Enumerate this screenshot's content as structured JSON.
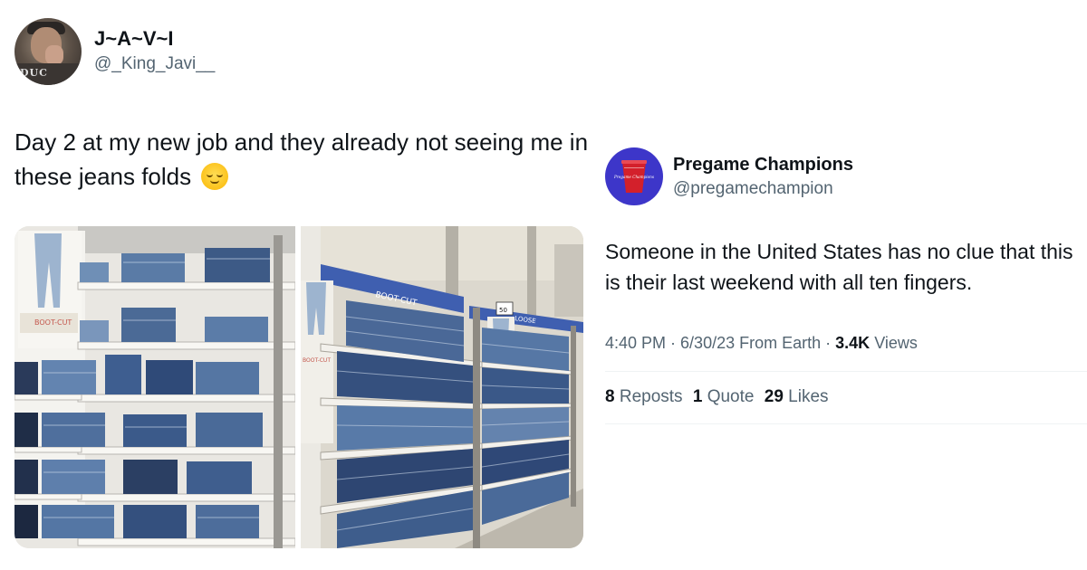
{
  "tweet1": {
    "display_name": "J~A~V~I",
    "handle": "@_King_Javi__",
    "avatar_shirt_text": "DUC",
    "text": "Day 2 at my new job and they already not seeing me in these jeans folds",
    "emoji": "relieved-face-emoji",
    "photo1": {
      "sign_label": "BOOT-CUT"
    },
    "photo2": {
      "sign_label": "BOOT-CUT",
      "side_sign_label": "BOOT-CUT",
      "price_tag": "50",
      "side_label": "LOOSE"
    }
  },
  "tweet2": {
    "display_name": "Pregame Champions",
    "handle": "@pregamechampion",
    "avatar_text": "Pregame Champions",
    "text": "Someone in the United States has no clue that this is their last weekend with all ten fingers.",
    "time": "4:40 PM",
    "date": "6/30/23",
    "source": "From Earth",
    "views_count": "3.4K",
    "views_label": "Views",
    "reposts_count": "8",
    "reposts_label": "Reposts",
    "quotes_count": "1",
    "quotes_label": "Quote",
    "likes_count": "29",
    "likes_label": "Likes"
  },
  "colors": {
    "text_primary": "#0f1419",
    "text_secondary": "#536471",
    "avatar2_bg": "#3d36c9",
    "cup_red": "#d3202b",
    "divider": "#eff3f4"
  }
}
